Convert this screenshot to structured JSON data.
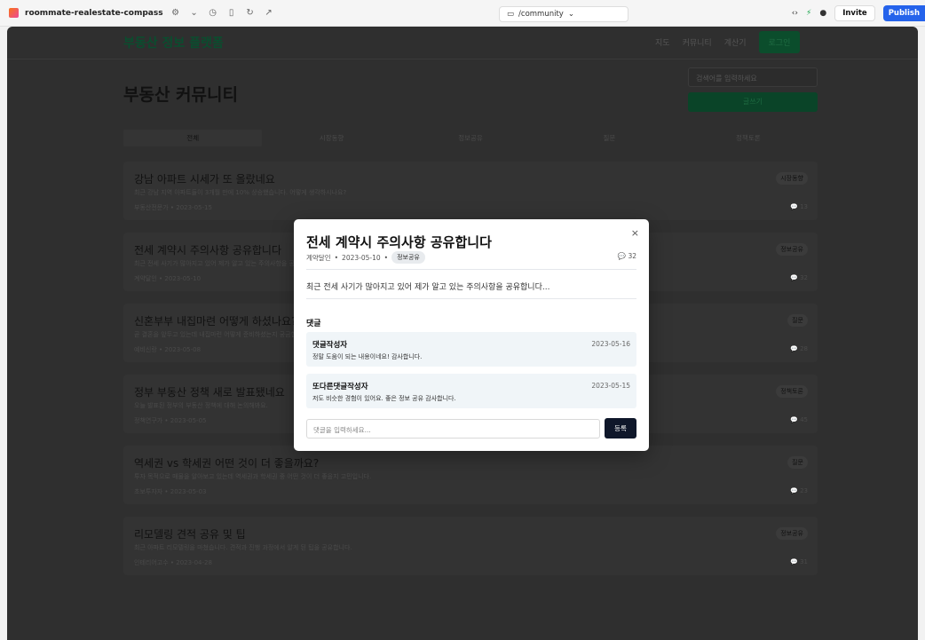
{
  "browser": {
    "project_name": "roommate-realestate-compass",
    "url": "/community",
    "invite_label": "Invite",
    "publish_label": "Publish"
  },
  "site": {
    "brand": "부동산 정보 플랫폼",
    "nav": [
      "지도",
      "커뮤니티",
      "계산기"
    ],
    "login_label": "로그인"
  },
  "community": {
    "title": "부동산 커뮤니티",
    "search_placeholder": "검색어를 입력하세요",
    "write_label": "글쓰기",
    "tabs": [
      "전체",
      "시장동향",
      "정보공유",
      "질문",
      "정책토론"
    ],
    "active_tab": "전체"
  },
  "posts": [
    {
      "title": "강남 아파트 시세가 또 올랐네요",
      "excerpt": "최근 강남 지역 아파트들이 3개월 만에 10% 상승했습니다. 어떻게 생각하시나요?",
      "author": "부동산전문가",
      "date": "2023-05-15",
      "category": "시장동향",
      "comments": "13"
    },
    {
      "title": "전세 계약시 주의사항 공유합니다",
      "excerpt": "최근 전세 사기가 많아지고 있어 제가 알고 있는 주의사항을 공유합니다...",
      "author": "계약달인",
      "date": "2023-05-10",
      "category": "정보공유",
      "comments": "32"
    },
    {
      "title": "신혼부부 내집마련 어떻게 하셨나요?",
      "excerpt": "곧 결혼을 앞두고 있는데 내집마련 어떻게 준비하셨는지 궁금합니다.",
      "author": "예비신랑",
      "date": "2023-05-08",
      "category": "질문",
      "comments": "28"
    },
    {
      "title": "정부 부동산 정책 새로 발표됐네요",
      "excerpt": "오늘 발표된 정부의 부동산 정책에 대해 논의해봐요.",
      "author": "정책연구가",
      "date": "2023-05-05",
      "category": "정책토론",
      "comments": "45"
    },
    {
      "title": "역세권 vs 학세권 어떤 것이 더 좋을까요?",
      "excerpt": "투자 목적으로 매물을 알아보고 있는데 역세권과 학세권 중 어떤 것이 더 좋을지 고민입니다.",
      "author": "초보투자자",
      "date": "2023-05-03",
      "category": "질문",
      "comments": "23"
    },
    {
      "title": "리모델링 견적 공유 및 팁",
      "excerpt": "최근 아파트 리모델링을 마쳤습니다. 견적과 진행 과정에서 알게 된 팁을 공유합니다.",
      "author": "인테리어고수",
      "date": "2023-04-28",
      "category": "정보공유",
      "comments": "31"
    }
  ],
  "modal": {
    "title": "전세 계약시 주의사항 공유합니다",
    "author": "계약달인",
    "date": "2023-05-10",
    "category": "정보공유",
    "comments_count": "32",
    "content": "최근 전세 사기가 많아지고 있어 제가 알고 있는 주의사항을 공유합니다...",
    "comments_heading": "댓글",
    "comments": [
      {
        "author": "댓글작성자",
        "date": "2023-05-16",
        "text": "정말 도움이 되는 내용이네요! 감사합니다."
      },
      {
        "author": "또다른댓글작성자",
        "date": "2023-05-15",
        "text": "저도 비슷한 경험이 있어요. 좋은 정보 공유 감사합니다."
      }
    ],
    "input_placeholder": "댓글을 입력하세요...",
    "submit_label": "등록",
    "close_glyph": "×"
  }
}
